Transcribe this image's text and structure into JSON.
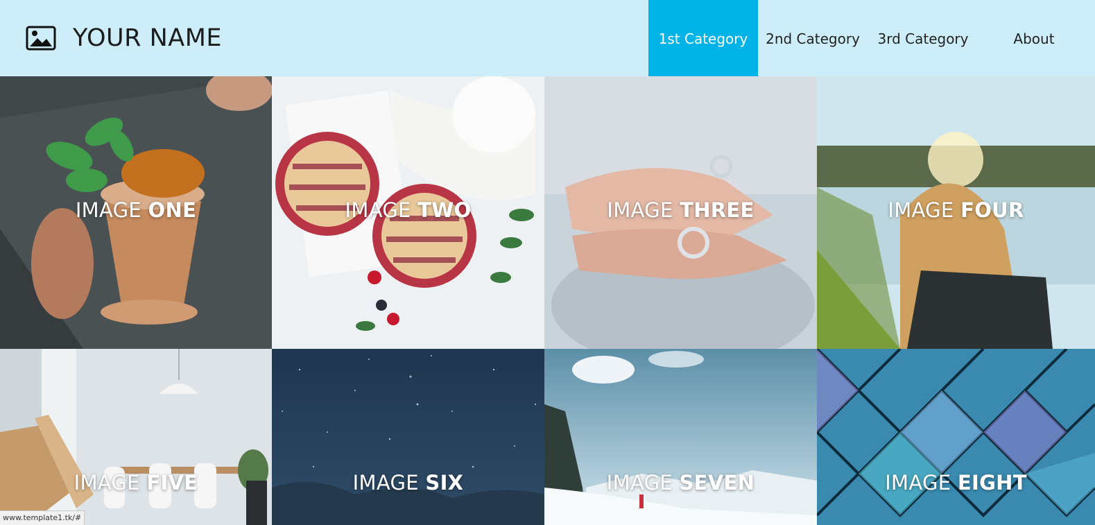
{
  "header": {
    "brand": "YOUR NAME",
    "logo_icon": "image-icon",
    "nav": [
      {
        "label": "1st Category",
        "active": true
      },
      {
        "label": "2nd Category",
        "active": false
      },
      {
        "label": "3rd Category",
        "active": false
      },
      {
        "label": "About",
        "active": false
      }
    ],
    "accent_color": "#00b3e6",
    "header_bg": "#cdeef8"
  },
  "tiles": [
    {
      "word": "IMAGE",
      "number": "ONE"
    },
    {
      "word": "IMAGE",
      "number": "TWO"
    },
    {
      "word": "IMAGE",
      "number": "THREE"
    },
    {
      "word": "IMAGE",
      "number": "FOUR"
    },
    {
      "word": "IMAGE",
      "number": "FIVE"
    },
    {
      "word": "IMAGE",
      "number": "SIX"
    },
    {
      "word": "IMAGE",
      "number": "SEVEN"
    },
    {
      "word": "IMAGE",
      "number": "EIGHT"
    }
  ],
  "status_bar": {
    "url": "www.template1.tk/#"
  }
}
